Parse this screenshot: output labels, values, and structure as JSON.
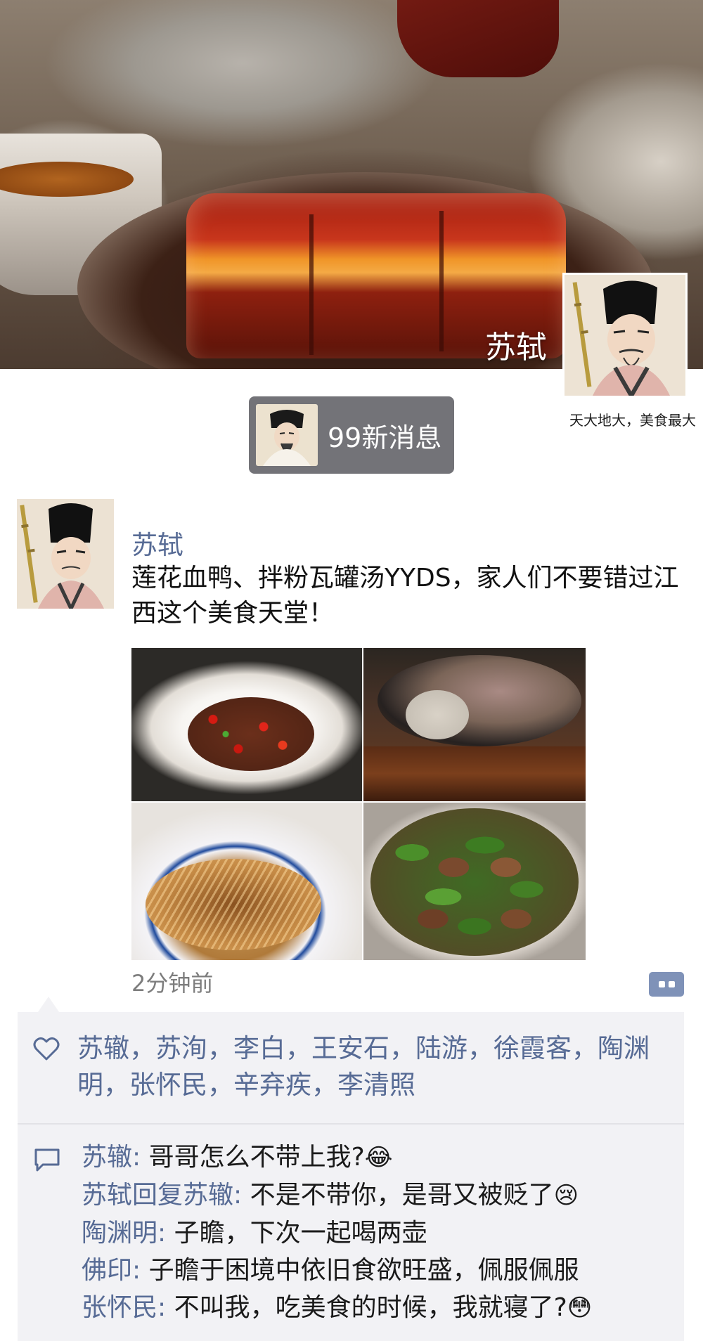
{
  "profile": {
    "cover_name": "苏轼",
    "signature": "天大地大，美食最大"
  },
  "notification": {
    "text": "99新消息"
  },
  "post": {
    "author": "苏轼",
    "text": "莲花血鸭、拌粉瓦罐汤YYDS，家人们不要错过江西这个美食天堂！",
    "time": "2分钟前",
    "likes": "苏辙，苏洵，李白，王安石，陆游，徐霞客，陶渊明，张怀民，辛弃疾，李清照",
    "comments": [
      {
        "who": "苏辙",
        "sep": ": ",
        "text": "哥哥怎么不带上我?",
        "emoji": "😂"
      },
      {
        "who": "苏轼回复苏辙",
        "sep": ": ",
        "text": "不是不带你，是哥又被贬了",
        "emoji": "😢"
      },
      {
        "who": "陶渊明",
        "sep": ": ",
        "text": "子瞻，下次一起喝两壶",
        "emoji": ""
      },
      {
        "who": "佛印",
        "sep": ": ",
        "text": "子瞻于困境中依旧食欲旺盛，佩服佩服",
        "emoji": ""
      },
      {
        "who": "张怀民",
        "sep": ": ",
        "text": "不叫我，吃美食的时候，我就寝了?",
        "emoji": "😳"
      }
    ]
  },
  "icons": {
    "more": "more-dots-icon",
    "like": "heart-icon",
    "comment": "comment-bubble-icon"
  },
  "colors": {
    "link_blue": "#576b95",
    "panel_bg": "#f2f2f5",
    "pill_bg": "#737378"
  }
}
